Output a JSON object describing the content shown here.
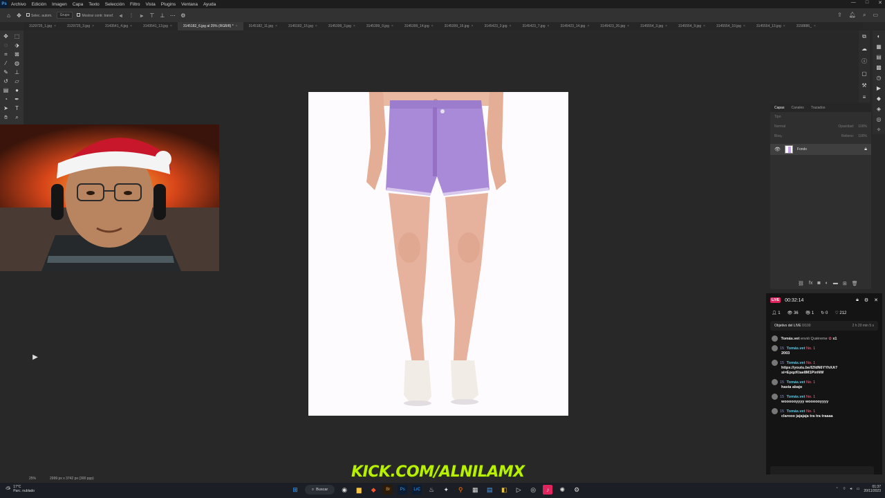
{
  "app": {
    "logo": "Ps"
  },
  "menu": [
    "Archivo",
    "Edición",
    "Imagen",
    "Capa",
    "Texto",
    "Selección",
    "Filtro",
    "Vista",
    "Plugins",
    "Ventana",
    "Ayuda"
  ],
  "window_controls": [
    "—",
    "□",
    "✕"
  ],
  "options": {
    "auto_select_label": "Selec. autom.",
    "group_value": "Grupo",
    "transform_label": "Mostrar contr. transf."
  },
  "tabs": [
    {
      "label": "3129725_1.jpg",
      "active": false
    },
    {
      "label": "3129725_3.jpg",
      "active": false
    },
    {
      "label": "3143541_4.jpg",
      "active": false
    },
    {
      "label": "3143541_13.jpg",
      "active": false
    },
    {
      "label": "3145182_6.jpg al 25% (RGB/8) *",
      "active": true
    },
    {
      "label": "3145182_11.jpg",
      "active": false
    },
    {
      "label": "3145182_15.jpg",
      "active": false
    },
    {
      "label": "3145399_3.jpg",
      "active": false
    },
    {
      "label": "3145399_9.jpg",
      "active": false
    },
    {
      "label": "3145399_14.jpg",
      "active": false
    },
    {
      "label": "3145399_16.jpg",
      "active": false
    },
    {
      "label": "3145423_3.jpg",
      "active": false
    },
    {
      "label": "3145423_7.jpg",
      "active": false
    },
    {
      "label": "3145423_14.jpg",
      "active": false
    },
    {
      "label": "3145423_26.jpg",
      "active": false
    },
    {
      "label": "3145554_3.jpg",
      "active": false
    },
    {
      "label": "3145554_9.jpg",
      "active": false
    },
    {
      "label": "3145554_10.jpg",
      "active": false
    },
    {
      "label": "3145554_13.jpg",
      "active": false
    },
    {
      "label": "3158886_",
      "active": false
    }
  ],
  "layers_panel": {
    "tabs": [
      "Capas",
      "Canales",
      "Trazados"
    ],
    "search_placeholder": "Tipo",
    "blend_mode": "Normal",
    "opacity_label": "Opacidad:",
    "opacity_value": "100%",
    "lock_label": "Bloq.:",
    "fill_label": "Relleno:",
    "fill_value": "100%",
    "layer_name": "Fondo"
  },
  "chat": {
    "live_badge": "LIVE",
    "timer": "00:32:14",
    "stats": {
      "users": "1",
      "viewers": "36",
      "gifts": "1",
      "shares": "0",
      "likes": "212"
    },
    "goal_label": "Objetivo del LIVE",
    "goal_progress": "0/100",
    "goal_time": "2 h 20 min 5 s",
    "gift_user": "Tomás.vet",
    "gift_text": "envió Quiéreme",
    "gift_count": "x1",
    "badge_level": "15",
    "badge_rank": "No. 1",
    "messages": [
      {
        "user": "Tomás.vet",
        "text": "2003"
      },
      {
        "user": "Tomás.vet",
        "text": "https://youtu.be/I2fdN6YYhXA?si=EpqzKtae8M1PinNW"
      },
      {
        "user": "Tomás.vet",
        "text": "hasta abajo"
      },
      {
        "user": "Tomás.vet",
        "text": "woooooyyyy woooooyyyy"
      },
      {
        "user": "Tomás.vet",
        "text": "clarooo jajajaja tra tra traaaa"
      }
    ]
  },
  "status": {
    "zoom": "25%",
    "doc_info": "2999 px x 3742 px (300 ppp)"
  },
  "watermark": "KICK.COM/ALNILAMX",
  "taskbar": {
    "temp": "17°C",
    "weather": "Parc. nublado",
    "search_label": "Buscar",
    "time": "01:37",
    "date": "20/11/2023"
  }
}
